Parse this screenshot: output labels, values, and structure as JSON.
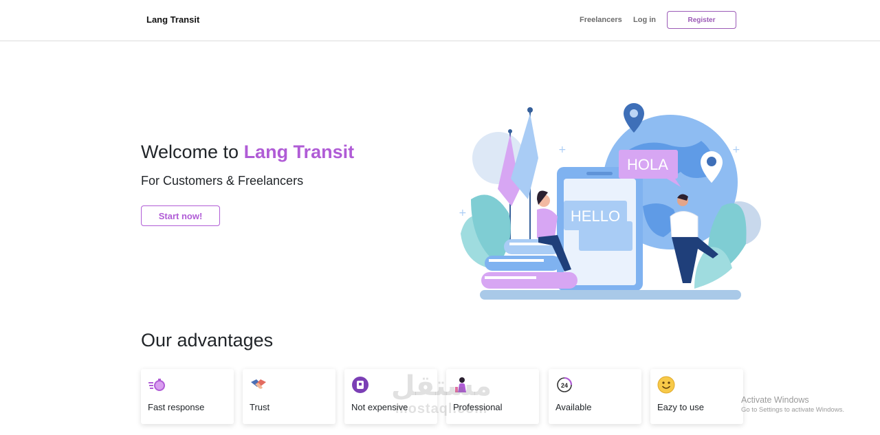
{
  "navbar": {
    "brand": "Lang Transit",
    "links": [
      "Freelancers",
      "Log in"
    ],
    "register_label": "Register"
  },
  "hero": {
    "title_prefix": "Welcome to ",
    "title_accent": "Lang Transit",
    "subtitle": "For Customers & Freelancers",
    "cta_label": "Start now!",
    "illustration": {
      "bubble_left": "HELLO",
      "bubble_right": "HOLA"
    }
  },
  "advantages": {
    "title": "Our advantages",
    "items": [
      {
        "label": "Fast response",
        "icon": "stopwatch-icon"
      },
      {
        "label": "Trust",
        "icon": "handshake-icon"
      },
      {
        "label": "Not expensive",
        "icon": "wallet-icon"
      },
      {
        "label": "Professional",
        "icon": "professional-person-icon"
      },
      {
        "label": "Available",
        "icon": "24-hours-icon"
      },
      {
        "label": "Eazy to use",
        "icon": "smiley-icon"
      }
    ]
  },
  "overlays": {
    "watermark_arabic": "مستقل",
    "watermark_latin": "mostaql.com",
    "activate_title": "Activate Windows",
    "activate_sub": "Go to Settings to activate Windows."
  },
  "colors": {
    "accent": "#b05cd6",
    "brand_purple": "#9b59b6",
    "illustration_blue": "#7fb2f0",
    "illustration_lilac": "#d7a6f3"
  }
}
